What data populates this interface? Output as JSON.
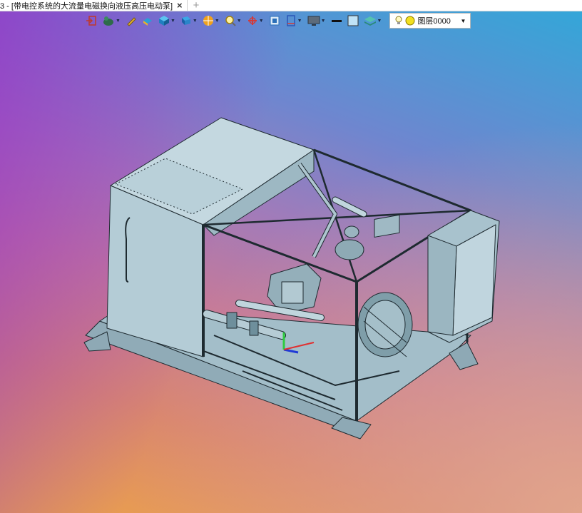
{
  "window": {
    "tab_title": "3 - [带电控系统的大流量电磁换向液压高压电动泵]",
    "close_icon": "×",
    "new_tab_icon": "+"
  },
  "toolbar": {
    "icons": [
      "exit-sketch-icon",
      "dog-view-icon",
      "pencil-icon",
      "paint-bucket-icon",
      "cube-icon",
      "view-cube-icon",
      "render-mode-icon",
      "zoom-icon",
      "rotate-icon",
      "fit-view-icon",
      "section-icon",
      "monitor-icon",
      "line-style-icon",
      "color-box-icon",
      "layer-stack-icon"
    ],
    "layer_label": "图层0000"
  },
  "colors": {
    "accent": "#1f6fd6",
    "model_fill": "#a9c4cf",
    "model_dark": "#6e8f9c",
    "model_line": "#1e2a30"
  }
}
